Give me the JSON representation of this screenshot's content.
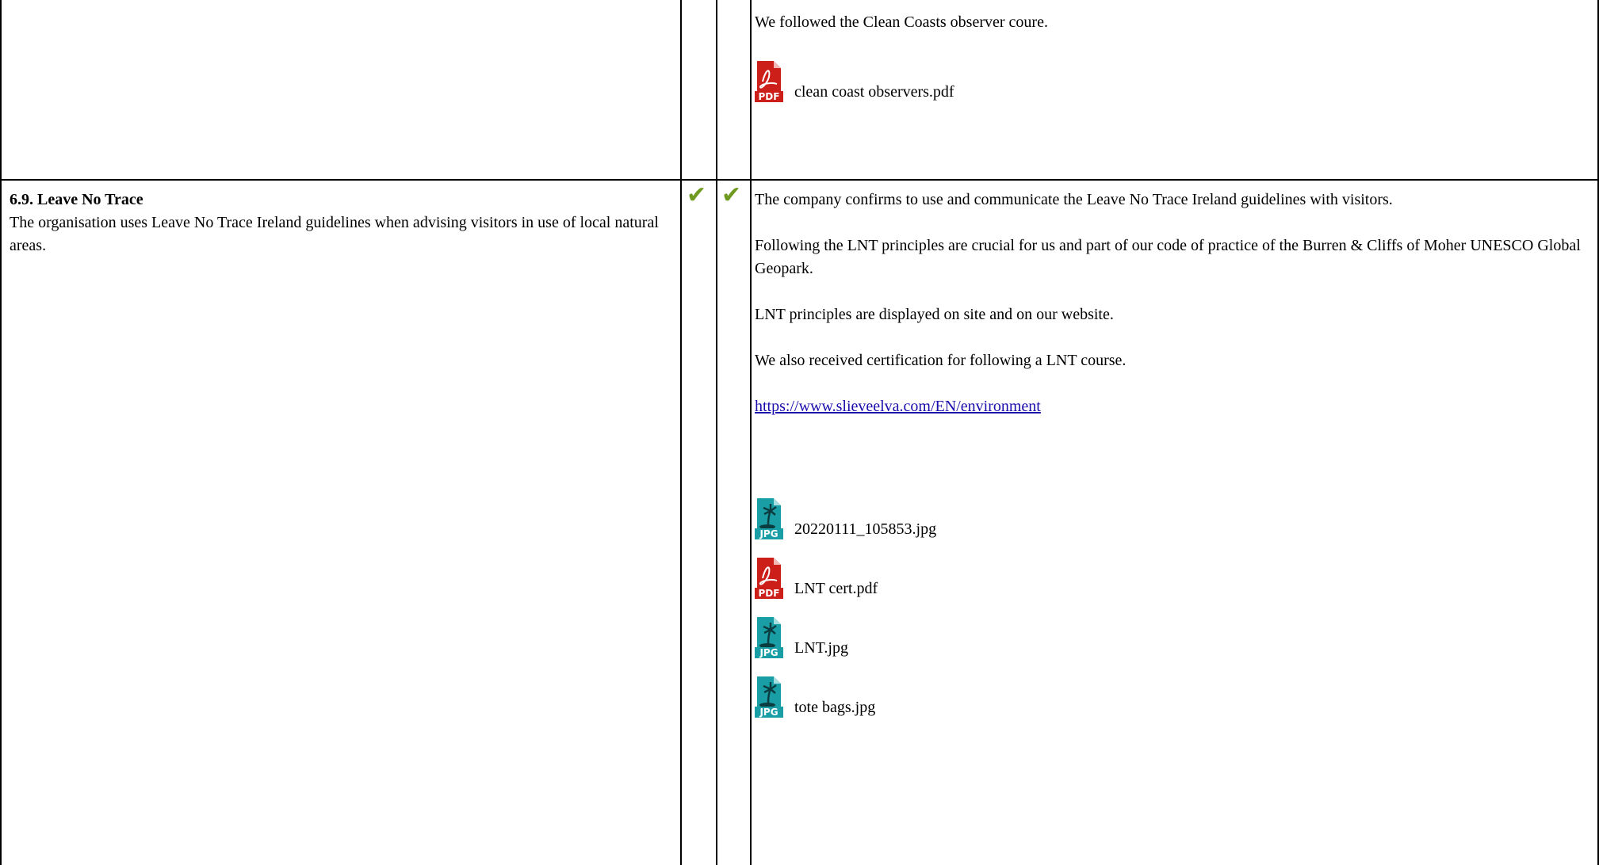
{
  "top_row": {
    "evidence_text": "We followed the Clean Coasts observer coure.",
    "attachments": [
      {
        "type": "PDF",
        "icon": "pdf-file-icon",
        "filename": "clean coast observers.pdf"
      }
    ]
  },
  "criterion": {
    "title": "6.9. Leave No Trace",
    "description": "The organisation uses Leave No Trace Ireland guidelines when advising visitors in use of local natural areas.",
    "check_1": "✔",
    "check_2": "✔",
    "check_color": "#6f9a1f",
    "paragraphs": [
      "The company confirms to use and communicate the Leave No Trace Ireland guidelines with visitors.",
      "Following the LNT principles are crucial for us and part of our code of practice of the Burren & Cliffs of Moher UNESCO Global Geopark.",
      "LNT principles are displayed on site and on our website.",
      "We also received certification for following a LNT course."
    ],
    "link": "https://www.slieveelva.com/EN/environment",
    "attachments": [
      {
        "type": "JPG",
        "icon": "jpg-file-icon",
        "filename": "20220111_105853.jpg"
      },
      {
        "type": "PDF",
        "icon": "pdf-file-icon",
        "filename": "LNT cert.pdf"
      },
      {
        "type": "JPG",
        "icon": "jpg-file-icon",
        "filename": "LNT.jpg"
      },
      {
        "type": "JPG",
        "icon": "jpg-file-icon",
        "filename": "tote bags.jpg"
      }
    ]
  }
}
